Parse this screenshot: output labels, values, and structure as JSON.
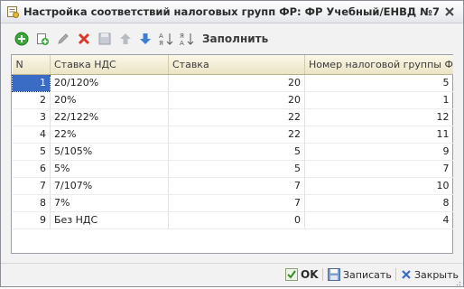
{
  "window": {
    "title": "Настройка соответствий налоговых групп ФР: ФР Учебный/ЕНВД №7"
  },
  "toolbar": {
    "fill_label": "Заполнить",
    "icons": [
      "add-icon",
      "copy-icon",
      "edit-icon",
      "delete-icon",
      "save-icon",
      "move-up-icon",
      "move-down-icon",
      "sort-asc-icon",
      "sort-desc-icon"
    ]
  },
  "table": {
    "columns": [
      "N",
      "Ставка НДС",
      "Ставка",
      "Номер налоговой группы ФР"
    ],
    "rows": [
      {
        "n": "1",
        "vat": "20/120%",
        "rate": "20",
        "group": "5"
      },
      {
        "n": "2",
        "vat": "20%",
        "rate": "20",
        "group": "1"
      },
      {
        "n": "3",
        "vat": "22/122%",
        "rate": "22",
        "group": "12"
      },
      {
        "n": "4",
        "vat": "22%",
        "rate": "22",
        "group": "11"
      },
      {
        "n": "5",
        "vat": "5/105%",
        "rate": "5",
        "group": "9"
      },
      {
        "n": "6",
        "vat": "5%",
        "rate": "5",
        "group": "7"
      },
      {
        "n": "7",
        "vat": "7/107%",
        "rate": "7",
        "group": "10"
      },
      {
        "n": "8",
        "vat": "7%",
        "rate": "7",
        "group": "8"
      },
      {
        "n": "9",
        "vat": "Без НДС",
        "rate": "0",
        "group": "4"
      }
    ]
  },
  "footer": {
    "ok_label": "OK",
    "save_label": "Записать",
    "close_label": "Закрыть"
  },
  "colors": {
    "selection": "#3a6cc6",
    "header_bg": "#f3eed6",
    "add_green": "#3aa53a",
    "delete_red": "#d83a2a",
    "arrow_blue": "#3d7fd4"
  }
}
